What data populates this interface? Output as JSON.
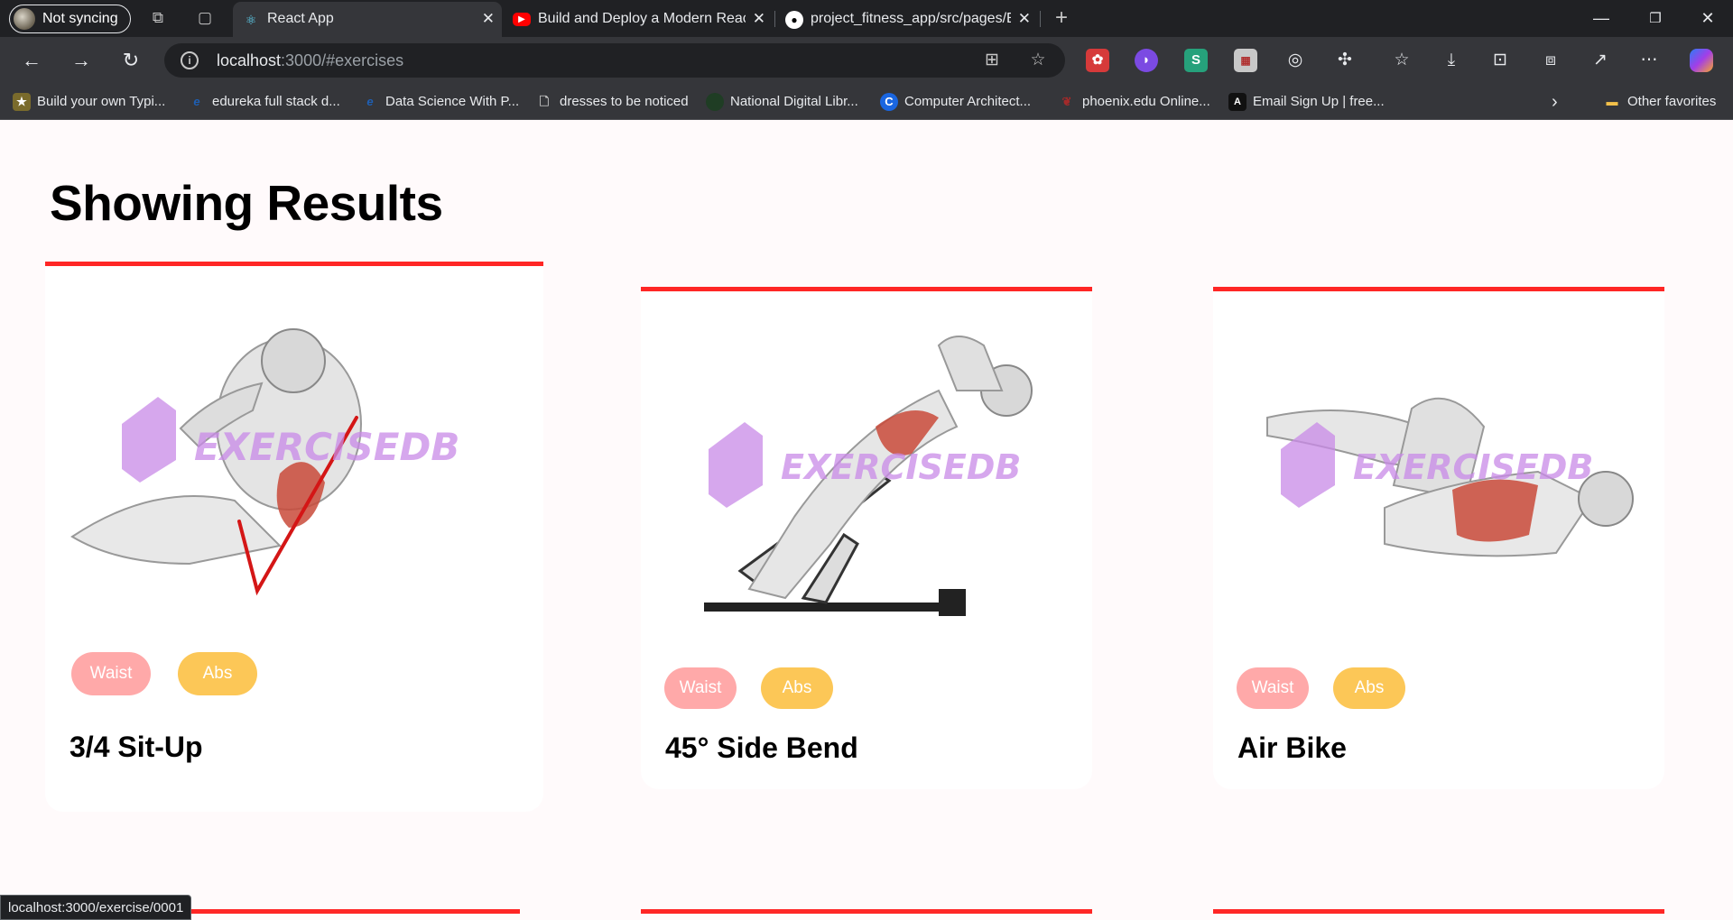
{
  "browser": {
    "profile_label": "Not syncing",
    "tabs": [
      {
        "title": "React App",
        "favicon": "react-icon",
        "active": true
      },
      {
        "title": "Build and Deploy a Modern React",
        "favicon": "youtube-icon",
        "active": false
      },
      {
        "title": "project_fitness_app/src/pages/Exe",
        "favicon": "github-icon",
        "active": false
      }
    ],
    "address": {
      "host": "localhost",
      "rest": ":3000/#exercises"
    },
    "bookmarks": [
      {
        "label": "Build your own Typi...",
        "icon": "ninja-icon",
        "color": "#7a6b2c"
      },
      {
        "label": "edureka full stack d...",
        "icon": "edureka-icon",
        "color": "#1e5fb4"
      },
      {
        "label": "Data Science With P...",
        "icon": "edureka-icon",
        "color": "#1e5fb4"
      },
      {
        "label": "dresses to be noticed",
        "icon": "page-icon",
        "color": "#35363a"
      },
      {
        "label": "National Digital Libr...",
        "icon": "library-icon",
        "color": "#1f3d24"
      },
      {
        "label": "Computer Architect...",
        "icon": "c-icon",
        "color": "#1a66e0"
      },
      {
        "label": "phoenix.edu Online...",
        "icon": "phoenix-icon",
        "color": "#a32a2a"
      },
      {
        "label": "Email Sign Up | free...",
        "icon": "angular-icon",
        "color": "#111111"
      }
    ],
    "other_favorites": "Other favorites",
    "status_url": "localhost:3000/exercise/0001"
  },
  "page": {
    "heading": "Showing Results",
    "watermark": "EXERCISEDB",
    "cards": [
      {
        "name": "3/4 Sit-Up",
        "tags": [
          "Waist",
          "Abs"
        ]
      },
      {
        "name": "45° Side Bend",
        "tags": [
          "Waist",
          "Abs"
        ]
      },
      {
        "name": "Air Bike",
        "tags": [
          "Waist",
          "Abs"
        ]
      }
    ]
  },
  "colors": {
    "accent": "#ff2625",
    "waist": "#ffa9a9",
    "abs": "#fcc757",
    "watermark": "#c98ae8"
  }
}
